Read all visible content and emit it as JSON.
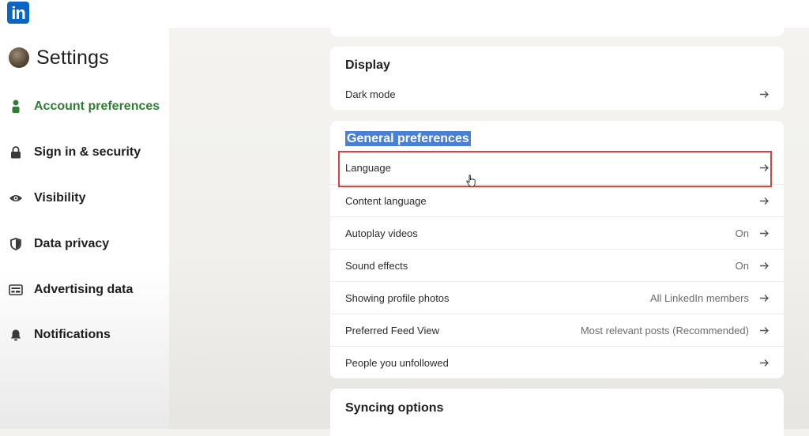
{
  "app": {
    "logo_text": "in"
  },
  "sidebar": {
    "title": "Settings",
    "items": [
      {
        "label": "Account preferences",
        "icon": "person-icon",
        "active": true
      },
      {
        "label": "Sign in & security",
        "icon": "lock-icon",
        "active": false
      },
      {
        "label": "Visibility",
        "icon": "eye-icon",
        "active": false
      },
      {
        "label": "Data privacy",
        "icon": "shield-icon",
        "active": false
      },
      {
        "label": "Advertising data",
        "icon": "ad-icon",
        "active": false
      },
      {
        "label": "Notifications",
        "icon": "bell-icon",
        "active": false
      }
    ]
  },
  "display": {
    "title": "Display",
    "rows": [
      {
        "label": "Dark mode",
        "value": ""
      }
    ]
  },
  "general": {
    "title": "General preferences",
    "rows": [
      {
        "label": "Language",
        "value": ""
      },
      {
        "label": "Content language",
        "value": ""
      },
      {
        "label": "Autoplay videos",
        "value": "On"
      },
      {
        "label": "Sound effects",
        "value": "On"
      },
      {
        "label": "Showing profile photos",
        "value": "All LinkedIn members"
      },
      {
        "label": "Preferred Feed View",
        "value": "Most relevant posts (Recommended)"
      },
      {
        "label": "People you unfollowed",
        "value": ""
      }
    ]
  },
  "syncing": {
    "title": "Syncing options"
  },
  "colors": {
    "brand": "#0a66c2",
    "active_nav": "#2e7d32",
    "highlight": "#4a7fd6",
    "annotation": "#d9433f"
  }
}
